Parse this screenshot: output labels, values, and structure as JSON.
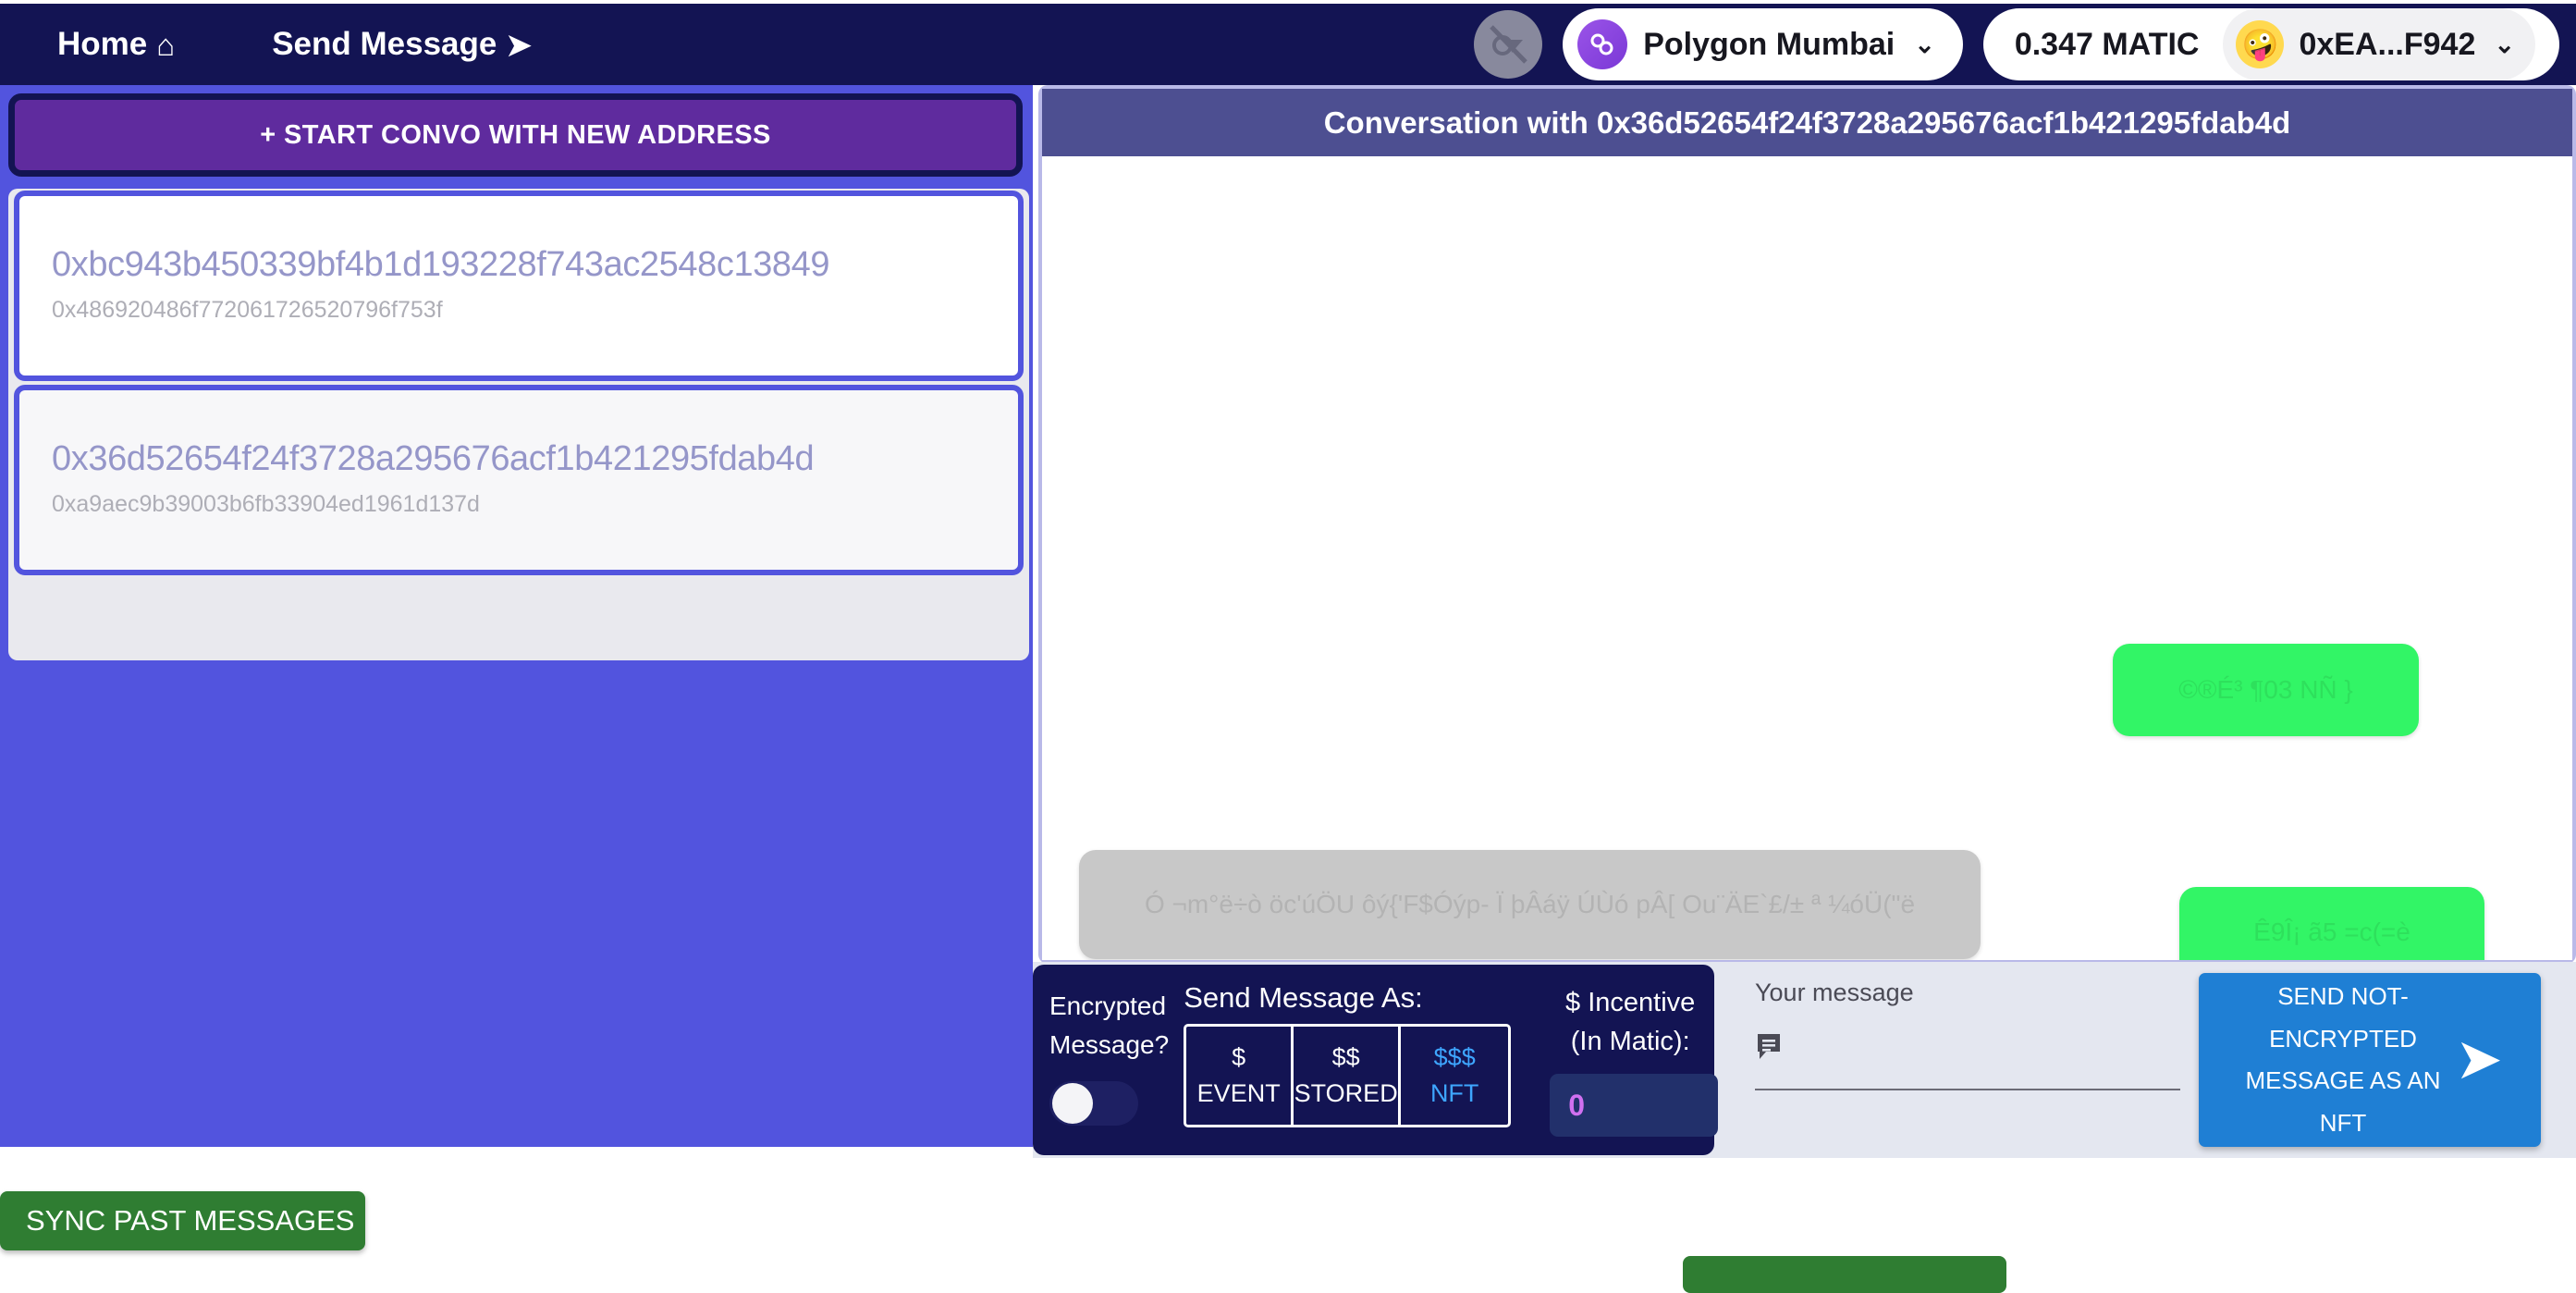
{
  "topnav": {
    "home_label": "Home",
    "home_icon": "home-icon",
    "home_glyph": "⌂",
    "send_label": "Send Message",
    "send_icon": "paper-plane-icon",
    "send_glyph": "➤",
    "logo_icon": "app-logo-icon",
    "network": {
      "label": "Polygon Mumbai",
      "icon": "polygon-network-icon",
      "chevron": "⌄"
    },
    "account": {
      "balance": "0.347 MATIC",
      "avatar_emoji": "🤪",
      "address": "0xEA...F942",
      "chevron": "⌄"
    }
  },
  "sidebar": {
    "new_convo_label": "+ START CONVO WITH NEW ADDRESS",
    "conversations": [
      {
        "address": "0xbc943b450339bf4b1d193228f743ac2548c13849",
        "subtitle": "0x486920486f772061726520796f753f",
        "selected": false
      },
      {
        "address": "0x36d52654f24f3728a295676acf1b421295fdab4d",
        "subtitle": "0xa9aec9b39003b6fb33904ed1961d137d",
        "selected": true
      }
    ],
    "sync_label": "SYNC PAST MESSAGES"
  },
  "conversation": {
    "header": "Conversation with 0x36d52654f24f3728a295676acf1b421295fdab4d",
    "messages": [
      {
        "text": "©®É³  ¶03  NÑ   }",
        "direction": "outgoing"
      },
      {
        "text": "Ó ¬m°ë÷ò  öc'úÖU  ôý{'F$Óýp-  Ï  þÂáÿ ÚÙó pÂ[  Ou¨ÄE`£/±  ª ¼óÜ(\"ë",
        "direction": "incoming"
      },
      {
        "text": "Ê9Î¡  ã5  =c(=è",
        "direction": "outgoing"
      }
    ]
  },
  "composer": {
    "encrypted_label_line1": "Encrypted",
    "encrypted_label_line2": "Message?",
    "encrypted_toggle_state": "off",
    "send_as_title": "Send Message As:",
    "send_as_options": [
      {
        "price": "$",
        "label": "EVENT",
        "active": false
      },
      {
        "price": "$$",
        "label": "STORED",
        "active": false
      },
      {
        "price": "$$$",
        "label": "NFT",
        "active": true
      }
    ],
    "incentive_label_line1": "$ Incentive",
    "incentive_label_line2": "(In Matic):",
    "incentive_value": "0",
    "message_label": "Your message",
    "message_icon": "chat-bubble-icon",
    "message_value": "",
    "message_placeholder": "",
    "send_button_label": "SEND NOT-ENCRYPTED MESSAGE AS AN NFT",
    "send_button_icon": "paper-plane-icon",
    "send_button_glyph": "➤"
  },
  "colors": {
    "nav_bg": "#131453",
    "sidebar_bg": "#5254DE",
    "new_convo_btn": "#5F2B9E",
    "convo_header_bg": "#4D4F91",
    "panel_border": "#B9B9E8",
    "outgoing_bubble": "#32F566",
    "incoming_bubble": "#C8C8C8",
    "options_card_bg": "#131453",
    "send_btn_bg": "#1F7FD4",
    "sync_btn_bg": "#2F7D32",
    "accent_active": "#3EA6FF",
    "incentive_text": "#D070F0"
  }
}
